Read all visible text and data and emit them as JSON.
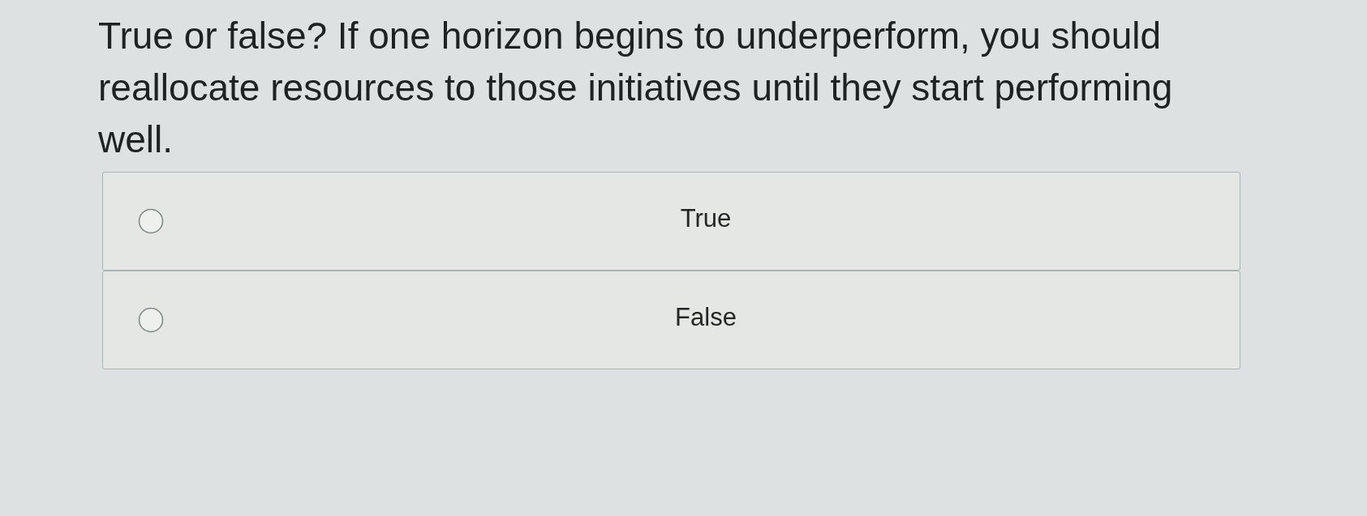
{
  "question": {
    "text": "True or false? If one horizon begins to underperform, you should reallocate resources to those initiatives until they start performing well."
  },
  "options": [
    {
      "label": "True",
      "selected": false
    },
    {
      "label": "False",
      "selected": false
    }
  ]
}
